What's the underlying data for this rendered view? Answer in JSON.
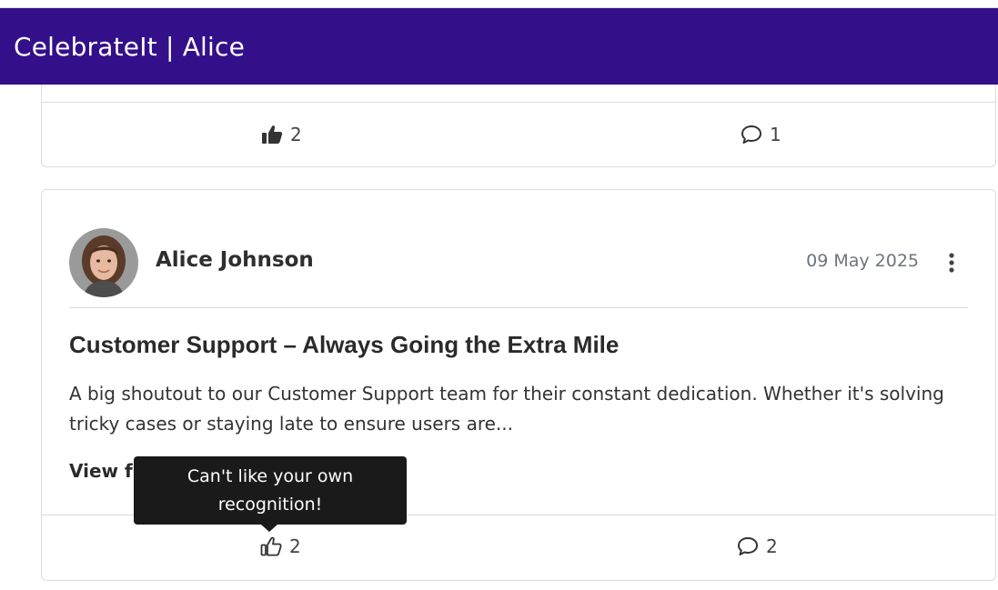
{
  "app": {
    "title": "CelebrateIt | Alice",
    "header_color": "#33108a"
  },
  "previous_post": {
    "likes": "2",
    "comments": "1"
  },
  "post": {
    "author": "Alice Johnson",
    "date": "09 May 2025",
    "title": "Customer Support – Always Going the Extra Mile",
    "body": "A big shoutout to our Customer Support team for their constant dedication. Whether it's solving tricky cases or staying late to ensure users are...",
    "view_full_label": "View full post",
    "likes": "2",
    "comments": "2",
    "avatar_icon": "user-avatar"
  },
  "tooltip": {
    "text": "Can't like your own recognition!"
  },
  "icons": {
    "like_filled": "thumbs-up-filled-icon",
    "like_outline": "thumbs-up-outline-icon",
    "comment": "comment-icon",
    "menu": "kebab-menu-icon"
  }
}
